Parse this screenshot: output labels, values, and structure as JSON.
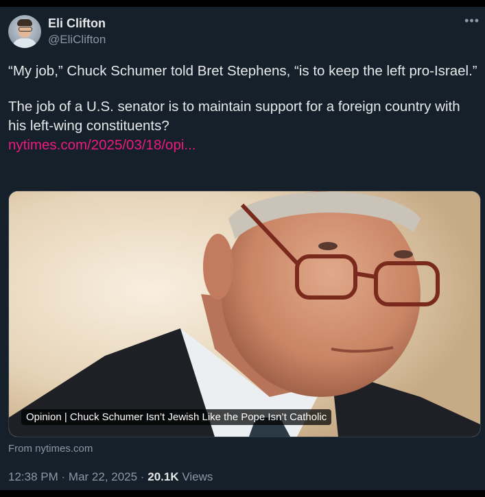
{
  "author": {
    "name": "Eli Clifton",
    "handle": "@EliClifton",
    "avatar_icon": "profile-photo"
  },
  "menu_icon": "more-dots-icon",
  "tweet": {
    "paragraph_1": "“My job,” Chuck Schumer told Bret Stephens, “is to keep the left pro-Israel.”",
    "paragraph_2": "The job of a U.S. senator is to maintain support for a foreign country with his left-wing constituents?",
    "link_text": "nytimes.com/2025/03/18/opi..."
  },
  "card": {
    "caption": "Opinion | Chuck Schumer Isn’t Jewish Like the Pope Isn’t Catholic",
    "source": "From nytimes.com"
  },
  "meta": {
    "time": "12:38 PM",
    "date": "Mar 22, 2025",
    "separator": "·",
    "views_count": "20.1K",
    "views_label": "Views"
  },
  "colors": {
    "background": "#15202b",
    "text": "#e7e9ea",
    "muted": "#8b98a5",
    "link": "#f0197d"
  }
}
